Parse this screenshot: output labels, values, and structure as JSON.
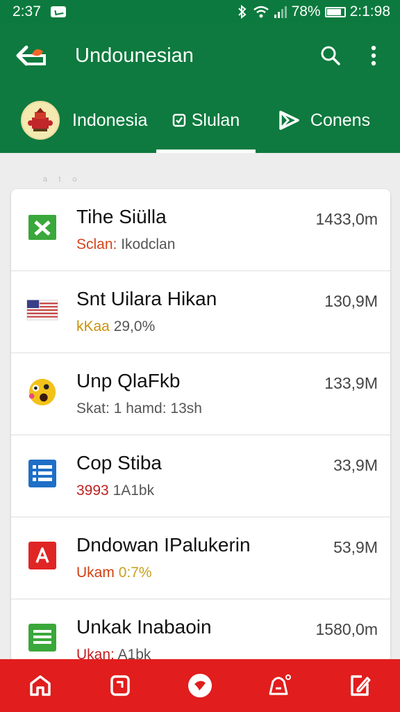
{
  "status_bar": {
    "time_left": "2:37",
    "battery_percent": "78%",
    "time_right": "2:1:98"
  },
  "app_bar": {
    "title": "Undounesian"
  },
  "tabs": [
    {
      "label": "Indonesia",
      "icon": "indonesia-emblem-icon"
    },
    {
      "label": "Slulan",
      "icon": "check-tag-icon",
      "active": true
    },
    {
      "label": "Conens",
      "icon": "play-forward-icon"
    }
  ],
  "header_faint": "ᵃ ᵗ ᵒ",
  "list": [
    {
      "icon": "spreadsheet-x-icon",
      "icon_color": "#3aa83a",
      "title": "Tihe Siülla",
      "sub_accent": "Sclan: ",
      "sub_rest": "Ikodclan",
      "sub_style": "sub-red",
      "value": "1433,0m"
    },
    {
      "icon": "flag-icon",
      "icon_color": "#c23030",
      "title": "Snt Uilara Hikan",
      "sub_accent": "kKaa ",
      "sub_rest": "29,0%",
      "sub_style": "sub-orange",
      "value": "130,9M"
    },
    {
      "icon": "emoji-face-icon",
      "icon_color": "#f2c21a",
      "title": "Unp QlaFkb",
      "sub_accent": "",
      "sub_rest": "Skat: 1 hamd: 13sh",
      "sub_style": "sub-gray",
      "value": "133,9M"
    },
    {
      "icon": "document-list-icon",
      "icon_color": "#1f6fc7",
      "title": "Cop Stiba",
      "sub_accent": "3993 ",
      "sub_rest": "1A1bk",
      "sub_style": "sub-darkred",
      "value": "33,9M"
    },
    {
      "icon": "pdf-document-icon",
      "icon_color": "#e02525",
      "title": "Dndowan IPalukerin",
      "sub_accent": "Ukam ",
      "sub_rest": "0:7%",
      "sub_style": "sub-orange2",
      "value": "53,9M"
    },
    {
      "icon": "sheet-lines-icon",
      "icon_color": "#3aa83a",
      "title": "Unkak Inabaoin",
      "sub_accent": "Ukan: ",
      "sub_rest": "A1bk",
      "sub_style": "sub-darkred",
      "value": "1580,0m"
    }
  ],
  "bottom_nav": [
    "home-icon",
    "tablet-icon",
    "record-icon",
    "bell-icon",
    "edit-icon"
  ]
}
